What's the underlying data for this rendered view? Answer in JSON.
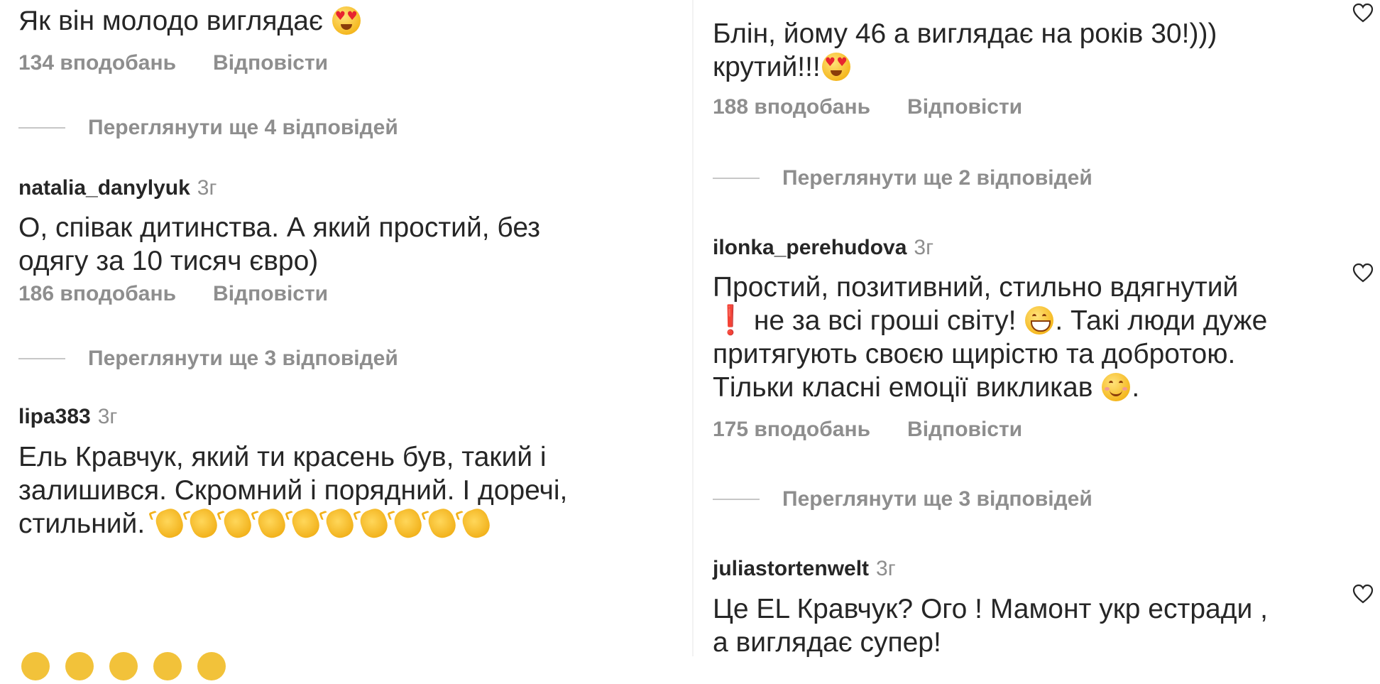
{
  "left_column": {
    "comment1": {
      "text": "Як він молодо виглядає",
      "emoji": "heart-eyes",
      "likes": "134 вподобань",
      "reply": "Відповісти",
      "more_replies": "Переглянути ще 4 відповідей"
    },
    "comment2": {
      "username": "natalia_danylyuk",
      "time": "3г",
      "line1": "О, співак дитинства. А який простий, без",
      "line2": "одягу за 10 тисяч євро)",
      "likes": "186 вподобань",
      "reply": "Відповісти",
      "more_replies": "Переглянути ще 3 відповідей"
    },
    "comment3": {
      "username": "lipa383",
      "time": "3г",
      "line1": "Ель Кравчук, який ти красень був, такий і",
      "line2": "залишився. Скромний і порядний. І доречі,",
      "line3": "стильний.",
      "emoji": "clapping-hands",
      "emoji_count": 10
    }
  },
  "right_column": {
    "comment1": {
      "line1": "Блін, йому 46 а виглядає на років 30!)))",
      "line2": "крутий!!!",
      "emoji": "heart-eyes",
      "likes": "188 вподобань",
      "reply": "Відповісти",
      "more_replies": "Переглянути ще 2 відповідей"
    },
    "comment2": {
      "username": "ilonka_perehudova",
      "time": "3г",
      "line1": "Простий, позитивний, стильно вдягнутий",
      "line2a": "❗",
      "line2b": "не за всі гроші світу!",
      "line2c": ". Такі люди дуже",
      "line3": "притягують своєю щирістю та добротою.",
      "line4": "Тільки класні емоції викликав",
      "line4_end": ".",
      "likes": "175 вподобань",
      "reply": "Відповісти",
      "more_replies": "Переглянути ще 3 відповідей"
    },
    "comment3": {
      "username": "juliastortenwelt",
      "time": "3г",
      "line1": "Це EL Кравчук?  Ого ! Мамонт укр естради ,",
      "line2": "а виглядає супер!"
    }
  },
  "icons": {
    "like": "heart-outline-icon",
    "emoji_heart_eyes": "smiling-face-with-heart-eyes",
    "emoji_grin": "grinning-face-with-smiling-eyes",
    "emoji_smile": "smiling-face-with-smiling-eyes",
    "emoji_clap": "clapping-hands",
    "emoji_exclamation": "red-exclamation-mark"
  },
  "colors": {
    "text": "#262626",
    "secondary": "#8e8e8e",
    "divider": "#c7c7c7",
    "exclamation": "#e0242a"
  }
}
